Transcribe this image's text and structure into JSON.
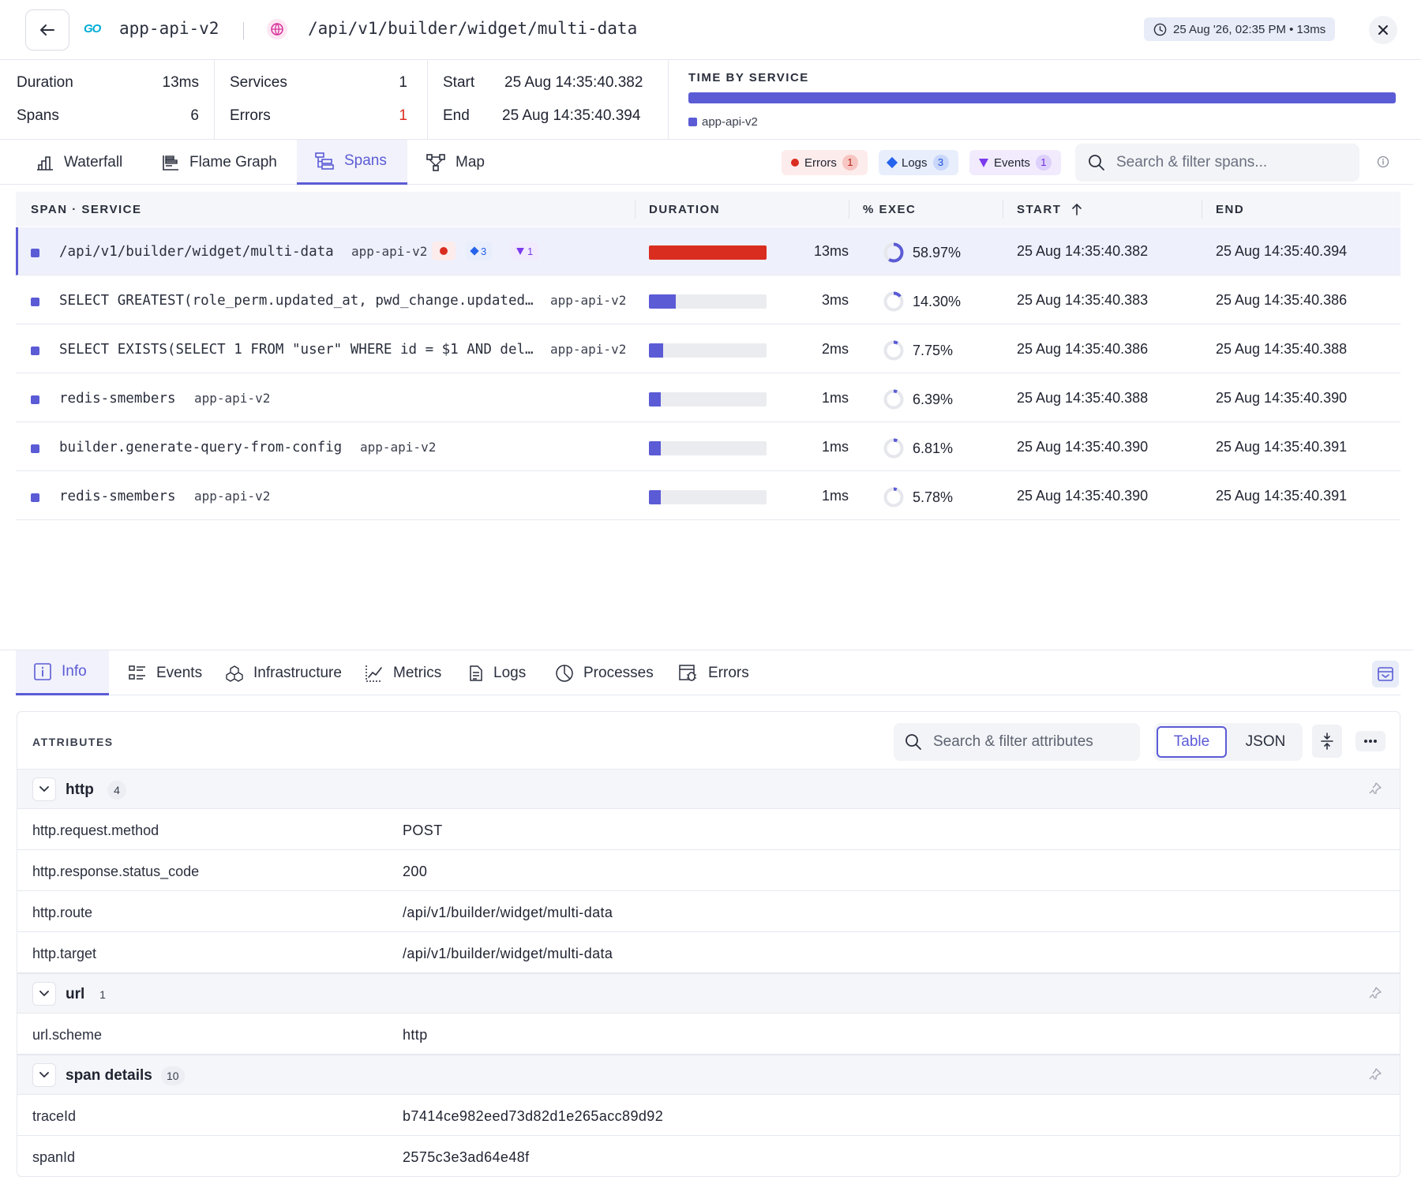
{
  "header": {
    "service_lang": "GO",
    "service_name": "app-api-v2",
    "route": "/api/v1/builder/widget/multi-data",
    "time_chip": "25 Aug '26, 02:35 PM • 13ms"
  },
  "summary": {
    "duration_label": "Duration",
    "duration_value": "13ms",
    "spans_label": "Spans",
    "spans_value": "6",
    "services_label": "Services",
    "services_value": "1",
    "errors_label": "Errors",
    "errors_value": "1",
    "start_label": "Start",
    "start_value": "25 Aug 14:35:40.382",
    "end_label": "End",
    "end_value": "25 Aug 14:35:40.394",
    "time_by_service_title": "TIME BY SERVICE",
    "time_by_service_legend": "app-api-v2",
    "time_by_service_share": 1.0
  },
  "view_tabs": [
    "Waterfall",
    "Flame Graph",
    "Spans",
    "Map"
  ],
  "filters": {
    "errors_label": "Errors",
    "errors_count": "1",
    "logs_label": "Logs",
    "logs_count": "3",
    "events_label": "Events",
    "events_count": "1",
    "search_placeholder": "Search & filter spans..."
  },
  "spans_table": {
    "columns": [
      "SPAN · SERVICE",
      "DURATION",
      "% EXEC",
      "START",
      "END"
    ],
    "rows": [
      {
        "name": "/api/v1/builder/widget/multi-data",
        "service": "app-api-v2",
        "duration": "13ms",
        "duration_fraction": 1.0,
        "exec": "58.97%",
        "exec_fraction": 0.5897,
        "start": "25 Aug 14:35:40.382",
        "end": "25 Aug 14:35:40.394",
        "logs": "3",
        "events": "1"
      },
      {
        "name": "SELECT GREATEST(role_perm.updated_at, pwd_change.updated…",
        "service": "app-api-v2",
        "duration": "3ms",
        "duration_fraction": 0.23,
        "exec": "14.30%",
        "exec_fraction": 0.143,
        "start": "25 Aug 14:35:40.383",
        "end": "25 Aug 14:35:40.386"
      },
      {
        "name": "SELECT EXISTS(SELECT 1 FROM \"user\" WHERE id = $1 AND del…",
        "service": "app-api-v2",
        "duration": "2ms",
        "duration_fraction": 0.12,
        "exec": "7.75%",
        "exec_fraction": 0.0775,
        "start": "25 Aug 14:35:40.386",
        "end": "25 Aug 14:35:40.388"
      },
      {
        "name": "redis-smembers",
        "service": "app-api-v2",
        "duration": "1ms",
        "duration_fraction": 0.1,
        "exec": "6.39%",
        "exec_fraction": 0.0639,
        "start": "25 Aug 14:35:40.388",
        "end": "25 Aug 14:35:40.390"
      },
      {
        "name": "builder.generate-query-from-config",
        "service": "app-api-v2",
        "duration": "1ms",
        "duration_fraction": 0.1,
        "exec": "6.81%",
        "exec_fraction": 0.0681,
        "start": "25 Aug 14:35:40.390",
        "end": "25 Aug 14:35:40.391"
      },
      {
        "name": "redis-smembers",
        "service": "app-api-v2",
        "duration": "1ms",
        "duration_fraction": 0.1,
        "exec": "5.78%",
        "exec_fraction": 0.0578,
        "start": "25 Aug 14:35:40.390",
        "end": "25 Aug 14:35:40.391"
      }
    ]
  },
  "detail_tabs": [
    "Info",
    "Events",
    "Infrastructure",
    "Metrics",
    "Logs",
    "Processes",
    "Errors"
  ],
  "attributes": {
    "title": "ATTRIBUTES",
    "search_placeholder": "Search & filter attributes",
    "view_table": "Table",
    "view_json": "JSON",
    "groups": [
      {
        "name": "http",
        "count": "4",
        "items": [
          {
            "key": "http.request.method",
            "value": "POST"
          },
          {
            "key": "http.response.status_code",
            "value": "200"
          },
          {
            "key": "http.route",
            "value": "/api/v1/builder/widget/multi-data"
          },
          {
            "key": "http.target",
            "value": "/api/v1/builder/widget/multi-data"
          }
        ]
      },
      {
        "name": "url",
        "count": "1",
        "items": [
          {
            "key": "url.scheme",
            "value": "http"
          }
        ]
      },
      {
        "name": "span details",
        "count": "10",
        "items": [
          {
            "key": "traceId",
            "value": "b7414ce982eed73d82d1e265acc89d92"
          },
          {
            "key": "spanId",
            "value": "2575c3e3ad64e48f"
          }
        ]
      }
    ]
  },
  "colors": {
    "accent": "#5b5bd6",
    "error": "#d92d20",
    "logs": "#2563eb",
    "events": "#7c3aed"
  }
}
